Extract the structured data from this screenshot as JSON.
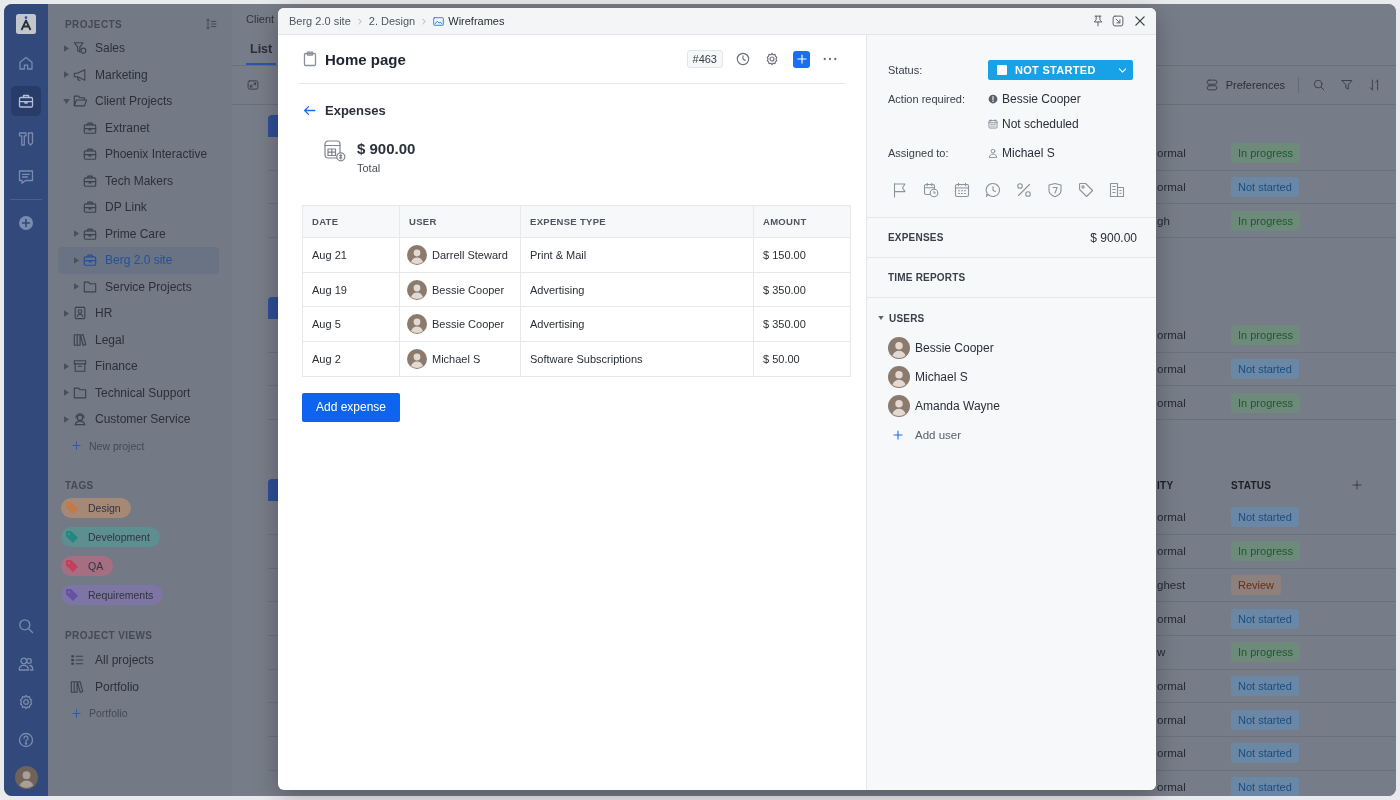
{
  "rail": {
    "top": [
      {
        "selected": false
      },
      {
        "selected": true
      },
      {
        "selected": false
      },
      {
        "selected": false
      }
    ]
  },
  "sidebar": {
    "projects_title": "PROJECTS",
    "projects": [
      {
        "label": "Sales",
        "expandable": true,
        "expanded": false,
        "selected": false
      },
      {
        "label": "Marketing",
        "expandable": true,
        "expanded": false,
        "selected": false
      },
      {
        "label": "Client Projects",
        "expandable": true,
        "expanded": true,
        "selected": false,
        "children": [
          {
            "label": "Extranet",
            "kind": "project",
            "expandable": false,
            "expanded": false,
            "selected": false
          },
          {
            "label": "Phoenix Interactive",
            "kind": "project",
            "expandable": false,
            "expanded": false,
            "selected": false
          },
          {
            "label": "Tech Makers",
            "kind": "project",
            "expandable": false,
            "expanded": false,
            "selected": false
          },
          {
            "label": "DP Link",
            "kind": "project",
            "expandable": false,
            "expanded": false,
            "selected": false
          },
          {
            "label": "Prime Care",
            "kind": "project",
            "expandable": true,
            "expanded": false,
            "selected": false
          },
          {
            "label": "Berg 2.0 site",
            "kind": "project",
            "expandable": true,
            "expanded": false,
            "selected": true
          },
          {
            "label": "Service Projects",
            "kind": "folder",
            "expandable": true,
            "expanded": false,
            "selected": false
          }
        ]
      },
      {
        "label": "HR",
        "expandable": true,
        "expanded": false,
        "selected": false
      },
      {
        "label": "Legal",
        "expandable": false,
        "expanded": false,
        "selected": false
      },
      {
        "label": "Finance",
        "expandable": true,
        "expanded": false,
        "selected": false
      },
      {
        "label": "Technical Support",
        "expandable": true,
        "expanded": false,
        "selected": false
      },
      {
        "label": "Customer Service",
        "expandable": true,
        "expanded": false,
        "selected": false
      }
    ],
    "new_project": "New project",
    "tags_title": "TAGS",
    "tags": [
      {
        "label": "Design",
        "color": "#c27a47"
      },
      {
        "label": "Development",
        "color": "#23897f"
      },
      {
        "label": "QA",
        "color": "#c23f5d"
      },
      {
        "label": "Requirements",
        "color": "#6650a8"
      }
    ],
    "views_title": "PROJECT VIEWS",
    "views": [
      {
        "label": "All projects"
      },
      {
        "label": "Portfolio"
      }
    ],
    "new_view": "Portfolio"
  },
  "main": {
    "breadcrumb": "Client",
    "tabs": [
      {
        "label": "List",
        "selected": true
      }
    ],
    "preferences": "Preferences",
    "groups": [
      {
        "rows": [
          {
            "priority": "ormal",
            "status": "In progress",
            "kind": "progress"
          },
          {
            "priority": "ormal",
            "status": "Not started",
            "kind": "waiting"
          },
          {
            "priority": "gh",
            "status": "In progress",
            "kind": "progress"
          }
        ]
      },
      {
        "rows": [
          {
            "priority": "ormal",
            "status": "In progress",
            "kind": "progress"
          },
          {
            "priority": "ormal",
            "status": "Not started",
            "kind": "waiting"
          },
          {
            "priority": "ormal",
            "status": "In progress",
            "kind": "progress"
          }
        ]
      },
      {
        "columns": [
          "ITY",
          "STATUS"
        ],
        "rows": [
          {
            "priority": "ormal",
            "status": "Not started",
            "kind": "waiting"
          },
          {
            "priority": "ormal",
            "status": "In progress",
            "kind": "progress"
          },
          {
            "priority": "ghest",
            "status": "Review",
            "kind": "review"
          },
          {
            "priority": "ormal",
            "status": "Not started",
            "kind": "waiting"
          },
          {
            "priority": "w",
            "status": "In progress",
            "kind": "progress"
          },
          {
            "priority": "ormal",
            "status": "Not started",
            "kind": "waiting"
          },
          {
            "priority": "ormal",
            "status": "Not started",
            "kind": "waiting"
          },
          {
            "priority": "ormal",
            "status": "Not started",
            "kind": "waiting"
          },
          {
            "priority": "ormal",
            "status": "Not started",
            "kind": "waiting"
          }
        ]
      }
    ]
  },
  "modal": {
    "breadcrumb": [
      "Berg 2.0 site",
      "2. Design",
      "Wireframes"
    ],
    "title": "Home page",
    "number": "#463",
    "back": "Expenses",
    "total": {
      "amount": "$ 900.00",
      "label": "Total"
    },
    "table": {
      "columns": [
        "DATE",
        "USER",
        "EXPENSE TYPE",
        "AMOUNT"
      ],
      "rows": [
        {
          "date": "Aug 21",
          "user": "Darrell Steward",
          "type": "Print & Mail",
          "amount": "$ 150.00"
        },
        {
          "date": "Aug 19",
          "user": "Bessie Cooper",
          "type": "Advertising",
          "amount": "$ 350.00"
        },
        {
          "date": "Aug 5",
          "user": "Bessie Cooper",
          "type": "Advertising",
          "amount": "$ 350.00"
        },
        {
          "date": "Aug 2",
          "user": "Michael S",
          "type": "Software Subscriptions",
          "amount": "$ 50.00"
        }
      ]
    },
    "add_button": "Add expense",
    "fields": {
      "status_label": "Status:",
      "status": "NOT STARTED",
      "action_label": "Action required:",
      "action_user": "Bessie Cooper",
      "schedule": "Not scheduled",
      "assigned_label": "Assigned to:",
      "assignee": "Michael S"
    },
    "sections": [
      {
        "title": "EXPENSES",
        "value": "$ 900.00"
      },
      {
        "title": "TIME REPORTS"
      }
    ],
    "users": {
      "title": "USERS",
      "expanded": true,
      "items": [
        {
          "name": "Bessie Cooper"
        },
        {
          "name": "Michael S"
        },
        {
          "name": "Amanda Wayne"
        }
      ],
      "add": "Add user"
    }
  }
}
